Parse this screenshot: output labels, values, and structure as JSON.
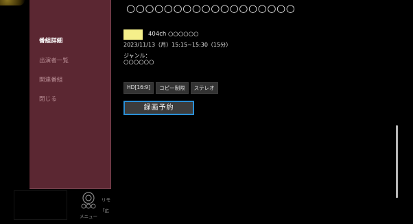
{
  "menu": {
    "items": [
      {
        "label": "番組詳細",
        "active": true
      },
      {
        "label": "出演者一覧",
        "active": false
      },
      {
        "label": "関連番組",
        "active": false
      },
      {
        "label": "閉じる",
        "active": false
      }
    ]
  },
  "program": {
    "title": "○○○○○○○○○○○○○○○○○○",
    "channel": "404ch ○○○○○○",
    "channel_color": "#f5ef8a",
    "broadcast_time": "2023/11/13（月）15:15~15:30（15分）",
    "genre_label": "ジャンル：",
    "genre_value": "○○○○○○",
    "badges": [
      "HD[16:9]",
      "コピー制限",
      "ステレオ"
    ],
    "record_button": "録画予約"
  },
  "remote": {
    "label": "メニュー",
    "text_top": "リモ",
    "text_bottom": "「広"
  },
  "colors": {
    "menu_bg": "#5b2732",
    "focus_border": "#2a8fd6"
  }
}
